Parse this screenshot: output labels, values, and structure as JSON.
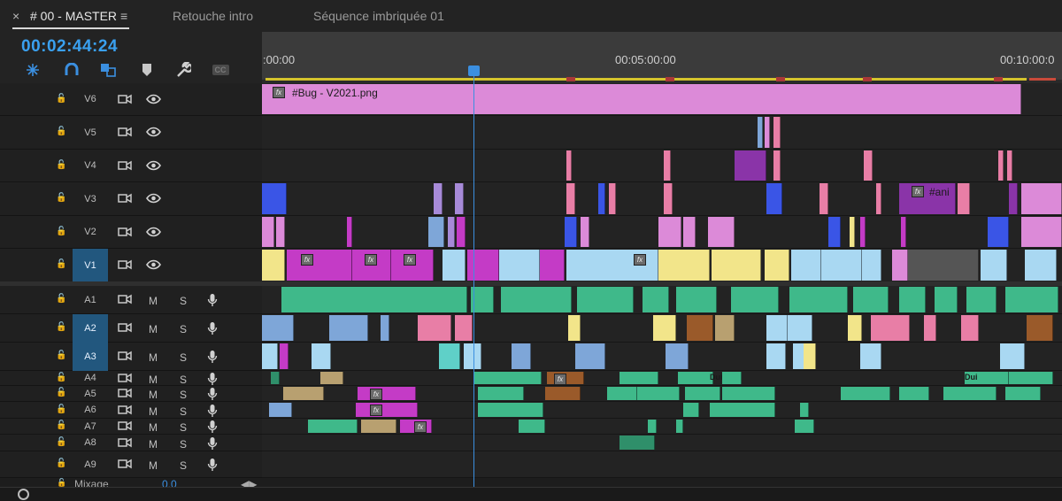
{
  "tabs": [
    {
      "label": "# 00 - MASTER",
      "active": true
    },
    {
      "label": "Retouche intro",
      "active": false
    },
    {
      "label": "Séquence imbriquée 01",
      "active": false
    }
  ],
  "tab_close": "×",
  "tab_menu": "≡",
  "timecode": "00:02:44:24",
  "ruler": {
    "labels": [
      ":00:00",
      "00:05:00:00",
      "00:10:00:0"
    ]
  },
  "tracks": [
    {
      "name": "V6",
      "type": "video"
    },
    {
      "name": "V5",
      "type": "video"
    },
    {
      "name": "V4",
      "type": "video"
    },
    {
      "name": "V3",
      "type": "video"
    },
    {
      "name": "V2",
      "type": "video"
    },
    {
      "name": "V1",
      "type": "video",
      "selected": true
    },
    {
      "name": "A1",
      "type": "audio"
    },
    {
      "name": "A2",
      "type": "audio",
      "selected": true
    },
    {
      "name": "A3",
      "type": "audio",
      "selected": true
    },
    {
      "name": "A4",
      "type": "audio"
    },
    {
      "name": "A5",
      "type": "audio"
    },
    {
      "name": "A6",
      "type": "audio"
    },
    {
      "name": "A7",
      "type": "audio"
    },
    {
      "name": "A8",
      "type": "audio"
    },
    {
      "name": "A9",
      "type": "audio"
    }
  ],
  "audio_buttons": {
    "mute": "M",
    "solo": "S"
  },
  "mix_label": "Mixage",
  "mix_value": "0,0",
  "clip_labels": {
    "v6_main": "#Bug - V2021.png",
    "v3_ani": "#ani",
    "fx": "fx",
    "duplicate": "Dui"
  },
  "colors": {
    "accent": "#3b8fe0",
    "timecode": "#3aa0ef",
    "pink_clip": "#dc8ad8",
    "magenta_clip": "#c43bc6",
    "blue_clip": "#3a55e6",
    "yellow_clip": "#f2e58a",
    "lightblue_clip": "#a9d8f2",
    "audio_green": "#3fb98a"
  },
  "icons": [
    "snap-icon",
    "magnet-icon",
    "linked-selection-icon",
    "marker-icon",
    "wrench-icon",
    "captions-icon",
    "lock-icon",
    "camera-toggle-icon",
    "eye-icon",
    "microphone-icon",
    "zoom-handle-icon"
  ],
  "captions_label": "CC"
}
